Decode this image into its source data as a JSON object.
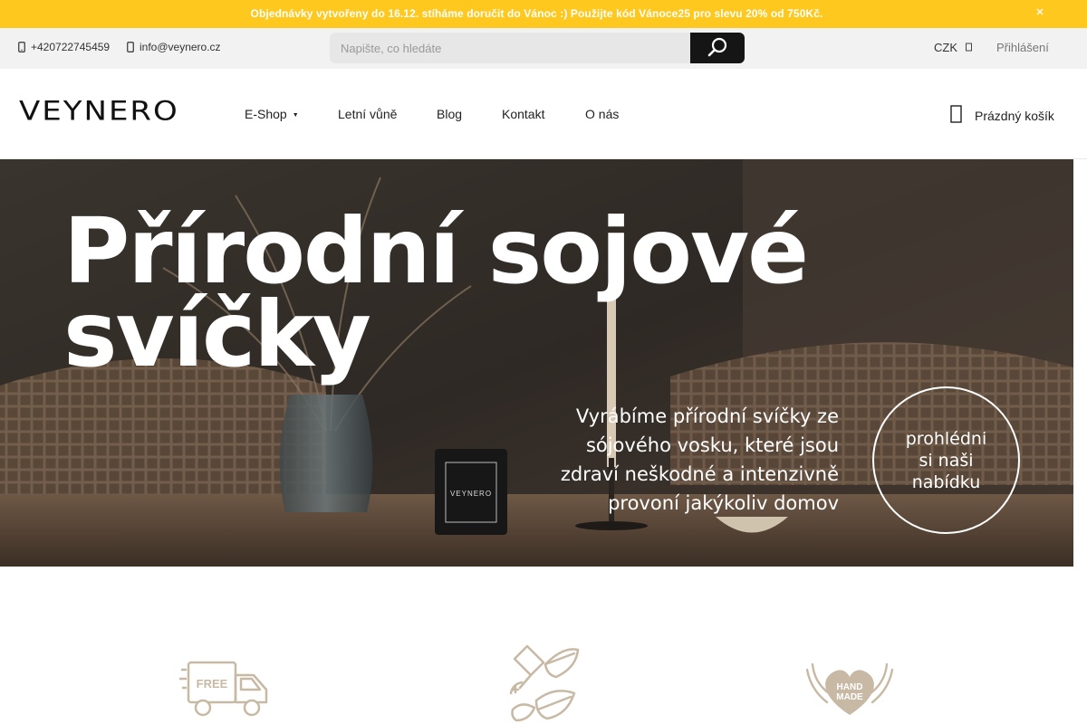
{
  "announcement": {
    "text": "Objednávky vytvořeny do 16.12. stíháme doručit do Vánoc :) Použijte kód Vánoce25 pro slevu 20% od 750Kč.",
    "close_icon": "close-icon"
  },
  "topbar": {
    "phone": "+420722745459",
    "email": "info@veynero.cz",
    "search_placeholder": "Napište, co hledáte",
    "search_icon": "search-icon",
    "currency": "CZK",
    "login": "Přihlášení"
  },
  "header": {
    "logo": "VEYNERO",
    "nav": [
      {
        "label": "E-Shop"
      },
      {
        "label": "Letní vůně"
      },
      {
        "label": "Blog"
      },
      {
        "label": "Kontakt"
      },
      {
        "label": "O nás"
      }
    ],
    "cart_label": "Prázdný košík",
    "cart_icon": "shopping-bag-icon"
  },
  "hero": {
    "title_line1": "Přírodní sojové",
    "title_line2": "svíčky",
    "subtitle_lines": [
      "Vyrábíme přírodní svíčky ze",
      "sójového vosku, které jsou",
      "zdraví neškodné a intenzivně",
      "provoní jakýkoliv domov"
    ],
    "cta_lines": [
      "prohlédni",
      "si naši",
      "nabídku"
    ],
    "candle_label": "VEYNERO"
  },
  "features": {
    "free_label": "FREE",
    "handmade_line1": "HAND",
    "handmade_line2": "MADE"
  },
  "colors": {
    "announcement_bg": "#ffc81e",
    "topbar_bg": "#f2f2f2",
    "search_button": "#151515",
    "feature_icon": "#c8b9a4"
  }
}
